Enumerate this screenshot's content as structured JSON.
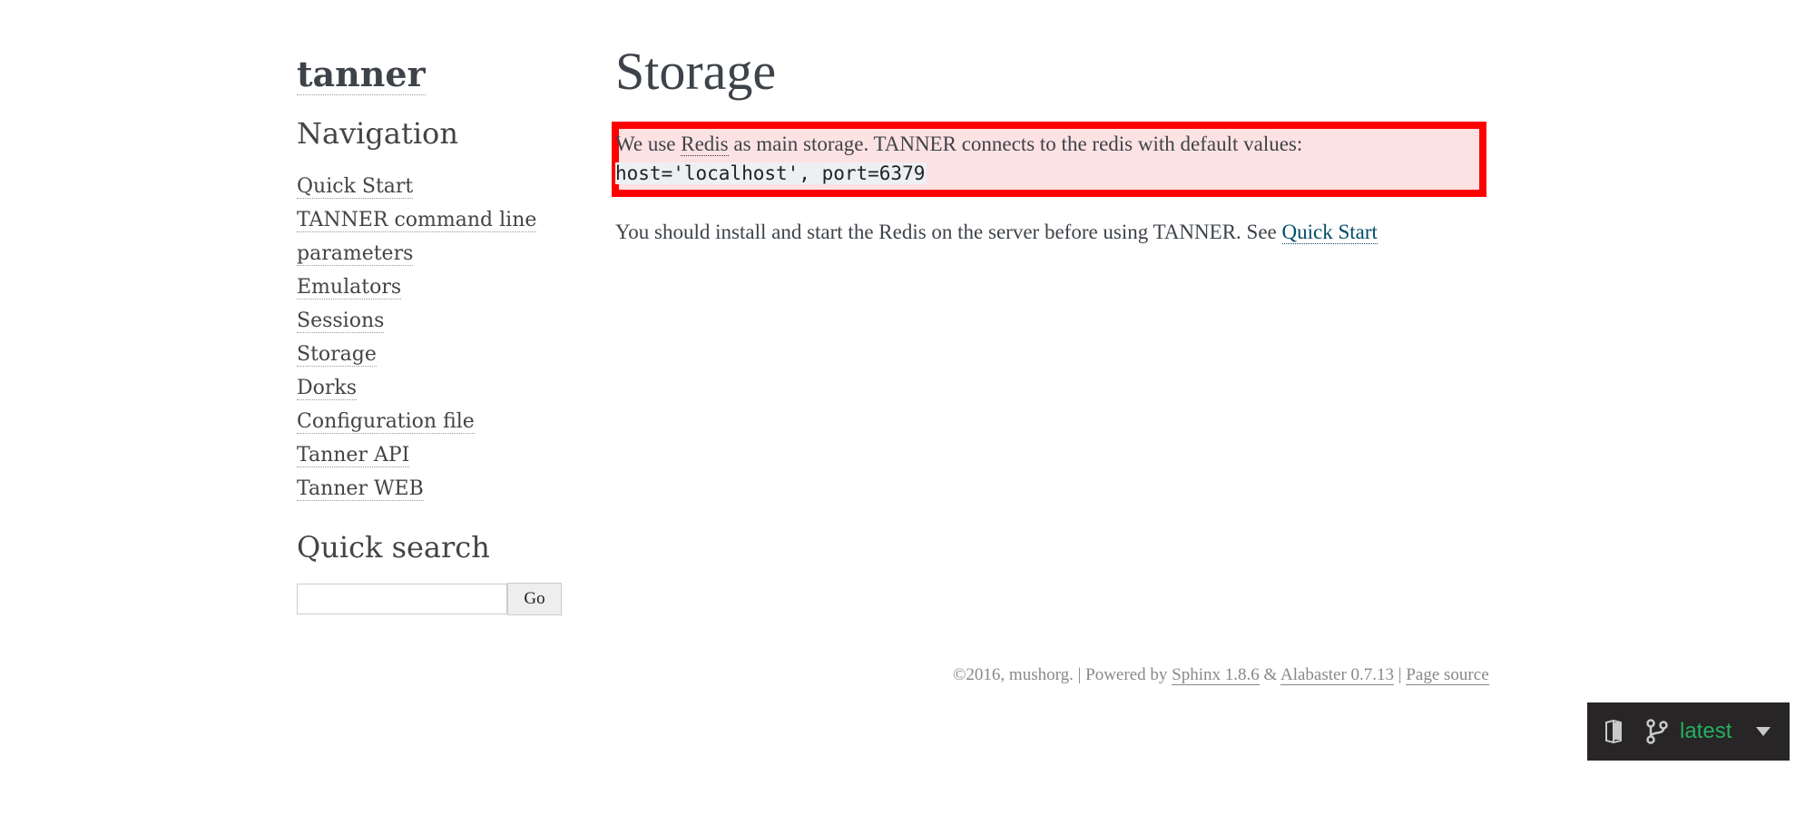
{
  "sidebar": {
    "logo": "tanner",
    "nav_title": "Navigation",
    "nav_items": [
      "Quick Start",
      "TANNER command line",
      "parameters",
      "Emulators",
      "Sessions",
      "Storage",
      "Dorks",
      "Configuration file",
      "Tanner API",
      "Tanner WEB"
    ],
    "search_title": "Quick search",
    "search_value": "",
    "go_label": "Go"
  },
  "main": {
    "title": "Storage",
    "p1_prefix": "We use ",
    "p1_link": "Redis",
    "p1_suffix": " as main storage. TANNER connects to the redis with default values:",
    "code": "host='localhost', port=6379",
    "p2_text": "You should install and start the Redis on the server before using TANNER. See ",
    "p2_link": "Quick Start"
  },
  "footer": {
    "copyright": "©2016, mushorg. | Powered by ",
    "sphinx": "Sphinx 1.8.6",
    "amp": " & ",
    "alabaster": "Alabaster 0.7.13",
    "sep": " | ",
    "page_source": "Page source"
  },
  "rtd": {
    "version": "latest"
  },
  "colors": {
    "highlight_border": "#ff0000",
    "highlight_bg": "#fde2e4",
    "rtd_bg": "#272525",
    "rtd_green": "#27ae60"
  }
}
